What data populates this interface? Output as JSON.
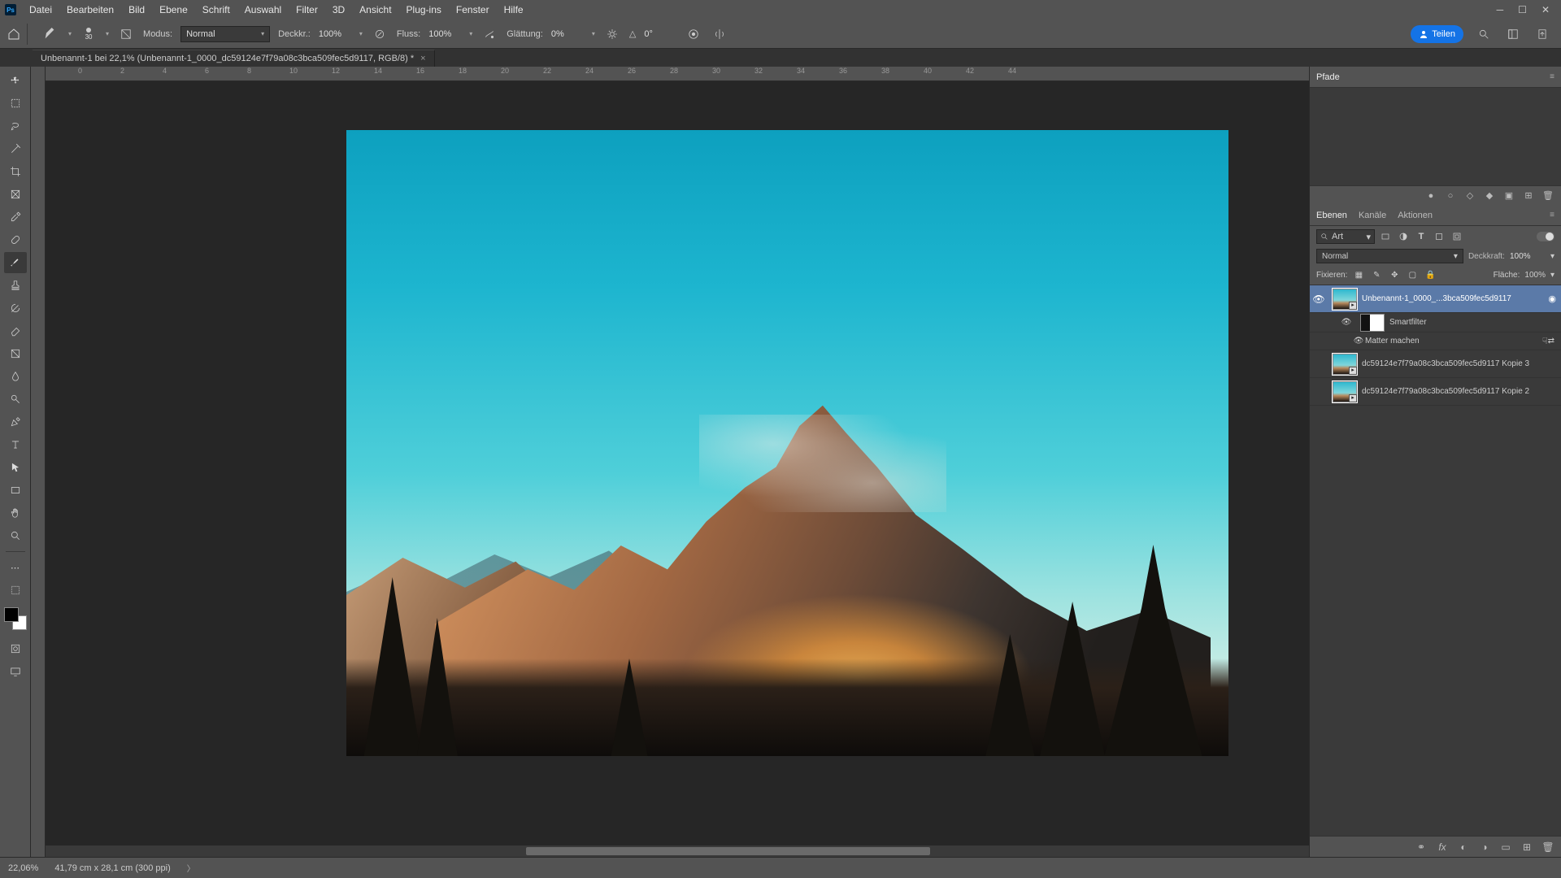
{
  "menubar": {
    "logo_text": "Ps",
    "items": [
      "Datei",
      "Bearbeiten",
      "Bild",
      "Ebene",
      "Schrift",
      "Auswahl",
      "Filter",
      "3D",
      "Ansicht",
      "Plug-ins",
      "Fenster",
      "Hilfe"
    ]
  },
  "optionsbar": {
    "brush_size_label": "30",
    "mode_label": "Modus:",
    "mode_value": "Normal",
    "opacity_label": "Deckkr.:",
    "opacity_value": "100%",
    "flow_label": "Fluss:",
    "flow_value": "100%",
    "smoothing_label": "Glättung:",
    "smoothing_value": "0%",
    "angle_label": "△",
    "angle_value": "0°",
    "share_label": "Teilen"
  },
  "doctab": {
    "title": "Unbenannt-1 bei 22,1% (Unbenannt-1_0000_dc59124e7f79a08c3bca509fec5d9117, RGB/8) *"
  },
  "ruler_marks": [
    "0",
    "2",
    "4",
    "6",
    "8",
    "10",
    "12",
    "14",
    "16",
    "18",
    "20",
    "22",
    "24",
    "26",
    "28",
    "30",
    "32",
    "34",
    "36",
    "38",
    "40",
    "42",
    "44"
  ],
  "panels": {
    "paths_tab": "Pfade",
    "layers_tabs": [
      "Ebenen",
      "Kanäle",
      "Aktionen"
    ],
    "search_label": "Art",
    "blend_mode": "Normal",
    "opacity_label": "Deckkraft:",
    "opacity_value": "100%",
    "lock_label": "Fixieren:",
    "fill_label": "Fläche:",
    "fill_value": "100%"
  },
  "layers": {
    "l1": {
      "name": "Unbenannt-1_0000_...3bca509fec5d9117"
    },
    "smartfilter_label": "Smartfilter",
    "filter_name": "Matter machen",
    "l2": {
      "name": "dc59124e7f79a08c3bca509fec5d9117 Kopie 3"
    },
    "l3": {
      "name": "dc59124e7f79a08c3bca509fec5d9117 Kopie 2"
    }
  },
  "statusbar": {
    "zoom": "22,06%",
    "doc_info": "41,79 cm x 28,1 cm (300 ppi)"
  }
}
